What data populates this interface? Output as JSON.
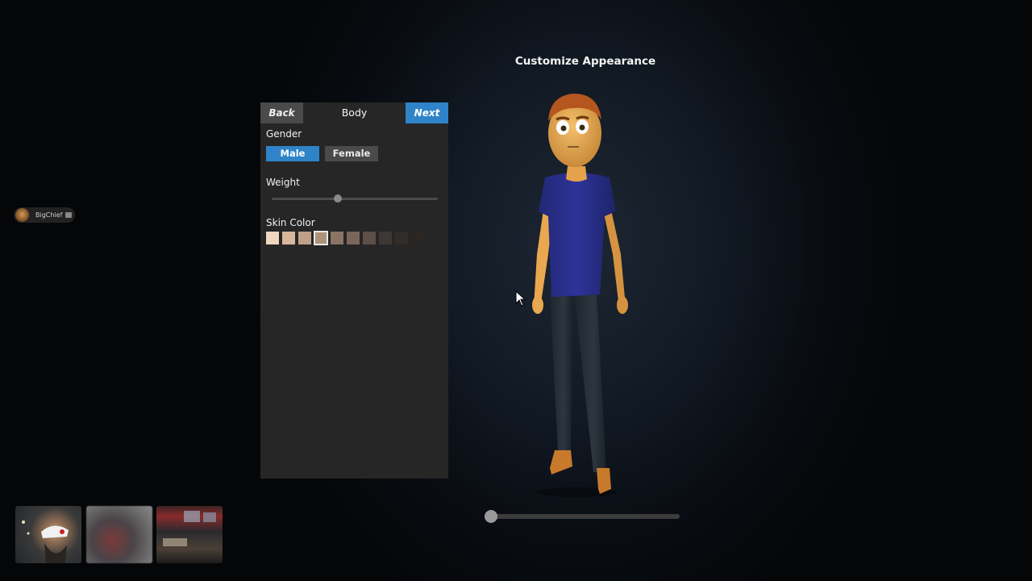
{
  "screen": {
    "title": "Customize Appearance"
  },
  "panel": {
    "back_label": "Back",
    "tab_label": "Body",
    "next_label": "Next",
    "gender": {
      "label": "Gender",
      "options": [
        "Male",
        "Female"
      ],
      "selected": "Male"
    },
    "weight": {
      "label": "Weight",
      "value_fraction": 0.4
    },
    "skin_color": {
      "label": "Skin Color",
      "swatches": [
        "#efd7c0",
        "#d8b79c",
        "#c0a088",
        "#ad9279",
        "#8a7464",
        "#7a665a",
        "#5d5048",
        "#3e3834",
        "#302c29",
        "#2a2624"
      ],
      "selected_index": 3
    }
  },
  "player": {
    "name": "BigChief"
  },
  "preview": {
    "rotation_fraction": 0.0
  },
  "colors": {
    "accent": "#2f84c9",
    "shirt": "#2a2f8a",
    "skin": "#e8a952",
    "hair": "#b5561f",
    "pants": "#2b323c",
    "shoes": "#c97a2a"
  }
}
